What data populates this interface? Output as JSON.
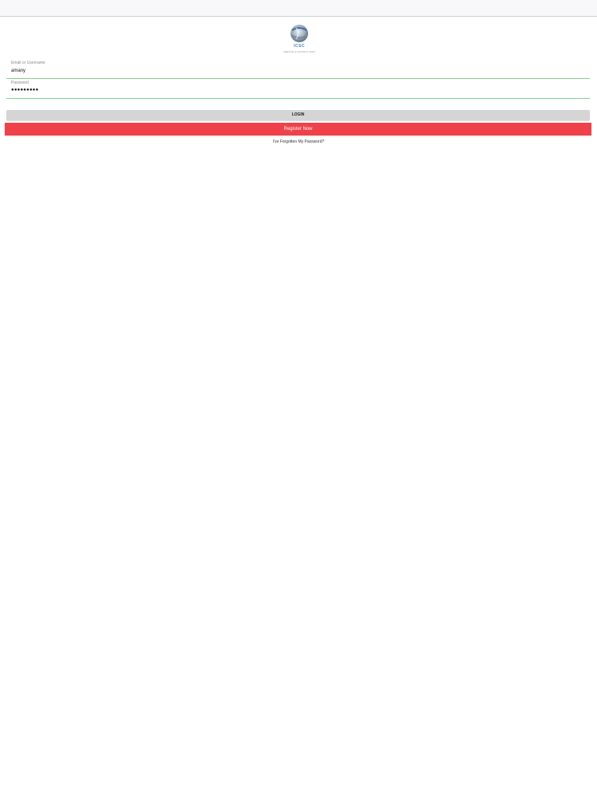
{
  "logo": {
    "text": "ICSC",
    "subtext": "SERVICE & CONTACT APPS"
  },
  "login_form": {
    "email_label": "Email or Username",
    "email_value": "amany",
    "password_label": "Password",
    "password_value": "●●●●●●●●●",
    "login_label": "LOGIN",
    "register_label": "Register Now",
    "forgot_label": "I've Forgotten My Password?"
  },
  "colors": {
    "accent_green": "#7fd28c",
    "register_red": "#f0414a",
    "login_gray": "#d5d5d5"
  }
}
